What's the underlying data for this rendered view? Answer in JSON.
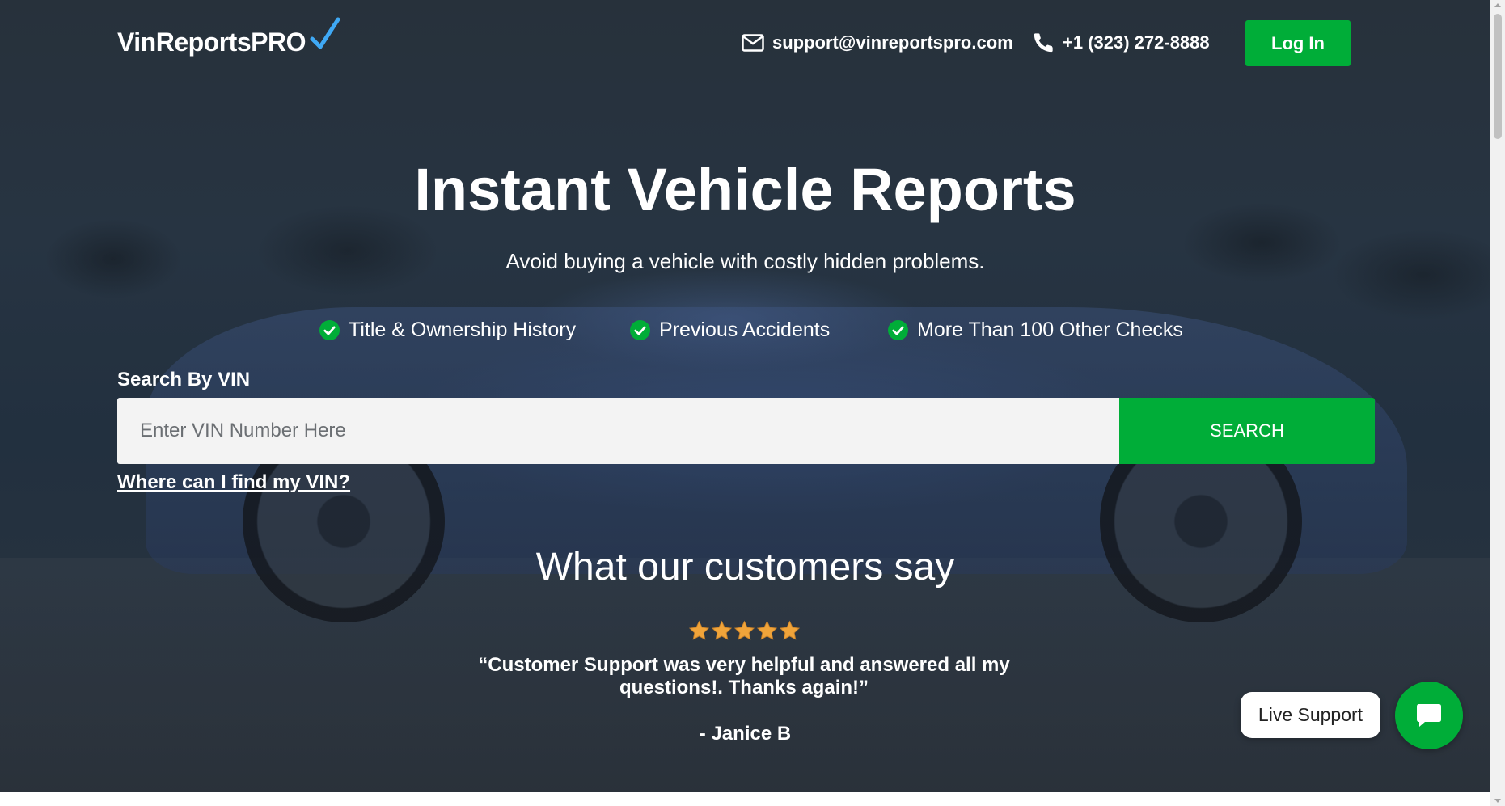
{
  "header": {
    "logo_text": "VinReportsPRO",
    "email": "support@vinreportspro.com",
    "phone": "+1 (323) 272-8888",
    "login_label": "Log In"
  },
  "hero": {
    "title": "Instant Vehicle Reports",
    "subtitle": "Avoid buying a vehicle with costly hidden problems.",
    "features": [
      "Title & Ownership History",
      "Previous Accidents",
      "More Than 100 Other Checks"
    ]
  },
  "search": {
    "label": "Search By VIN",
    "placeholder": "Enter VIN Number Here",
    "value": "",
    "button_label": "SEARCH",
    "help_link": "Where can I find my VIN?"
  },
  "reviews": {
    "title": "What our customers say",
    "rating": 5,
    "rating_max": 5,
    "quote": "“Customer Support was very helpful and answered all my questions!. Thanks again!”",
    "author": "- Janice B"
  },
  "chat": {
    "live_support_label": "Live Support"
  },
  "colors": {
    "accent_green": "#00ad38",
    "star_orange": "#f0a43a",
    "logo_check_blue": "#3fa9f5"
  }
}
